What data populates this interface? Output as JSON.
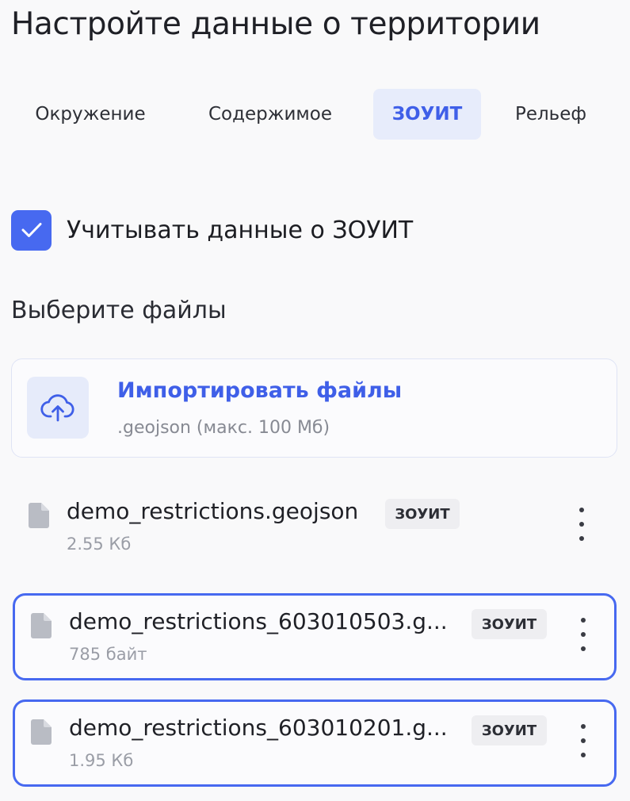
{
  "title": "Настройте данные о территории",
  "tabs": [
    {
      "label": "Окружение",
      "active": false
    },
    {
      "label": "Содержимое",
      "active": false
    },
    {
      "label": "ЗОУИТ",
      "active": true
    },
    {
      "label": "Рельеф",
      "active": false
    }
  ],
  "checkbox": {
    "label": "Учитывать данные о ЗОУИТ",
    "checked": true
  },
  "files_section_label": "Выберите файлы",
  "upload": {
    "title": "Импортировать файлы",
    "subtitle": ".geojson (макс. 100 Мб)",
    "icon": "cloud-upload-icon"
  },
  "files": [
    {
      "name": "demo_restrictions.geojson",
      "badge": "ЗОУИТ",
      "size": "2.55 Кб",
      "selected": false
    },
    {
      "name": "demo_restrictions_603010503.g...",
      "badge": "ЗОУИТ",
      "size": "785 байт",
      "selected": true
    },
    {
      "name": "demo_restrictions_603010201.g...",
      "badge": "ЗОУИТ",
      "size": "1.95 Кб",
      "selected": true
    }
  ],
  "colors": {
    "accent": "#4769f0",
    "accent_text": "#3f5fe8",
    "accent_bg": "#e7ecfb",
    "badge_bg": "#eeeef1"
  }
}
